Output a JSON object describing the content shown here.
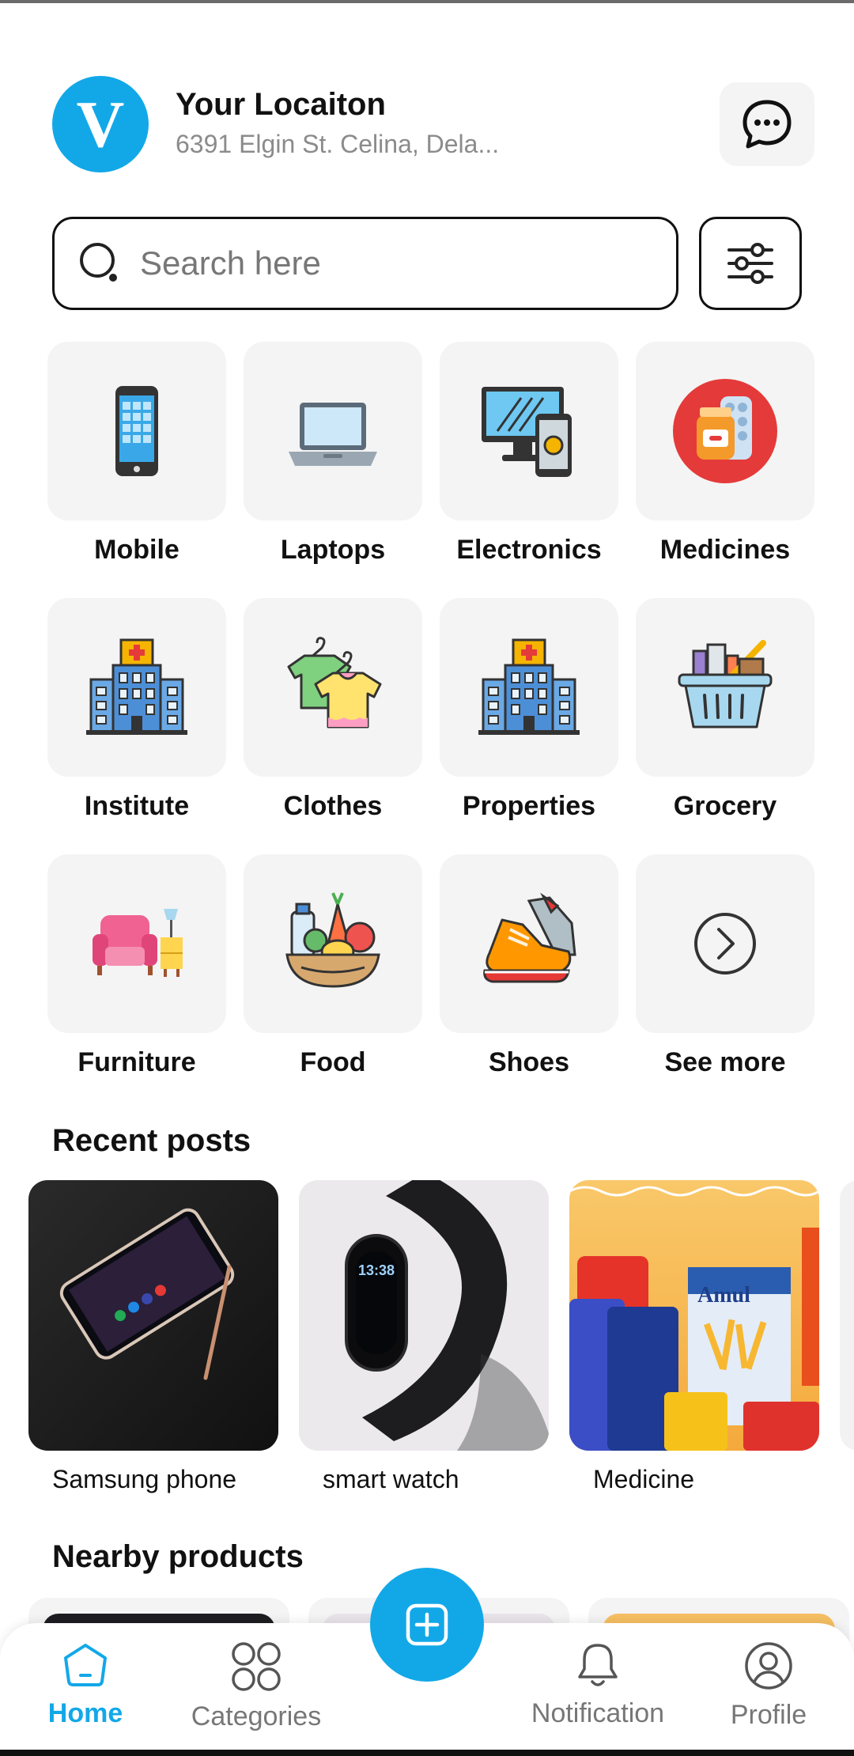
{
  "header": {
    "avatar_letter": "V",
    "location_title": "Your Locaiton",
    "location_address": "6391 Elgin St. Celina, Dela..."
  },
  "search": {
    "placeholder": "Search here"
  },
  "categories": [
    {
      "label": "Mobile",
      "icon": "mobile-phone-icon"
    },
    {
      "label": "Laptops",
      "icon": "laptop-icon"
    },
    {
      "label": "Electronics",
      "icon": "electronics-icon"
    },
    {
      "label": "Medicines",
      "icon": "medicine-icon"
    },
    {
      "label": "Institute",
      "icon": "institute-building-icon"
    },
    {
      "label": "Clothes",
      "icon": "clothes-icon"
    },
    {
      "label": "Properties",
      "icon": "properties-building-icon"
    },
    {
      "label": "Grocery",
      "icon": "grocery-basket-icon"
    },
    {
      "label": "Furniture",
      "icon": "furniture-icon"
    },
    {
      "label": "Food",
      "icon": "food-basket-icon"
    },
    {
      "label": "Shoes",
      "icon": "shoes-icon"
    },
    {
      "label": "See more",
      "icon": "chevron-right-circle-icon"
    }
  ],
  "recent_posts": {
    "title": "Recent posts",
    "items": [
      {
        "caption": "Samsung phone"
      },
      {
        "caption": "smart watch",
        "watch_time": "13:38"
      },
      {
        "caption": "Medicine",
        "brand_text": "Amul"
      }
    ]
  },
  "nearby": {
    "title": "Nearby products"
  },
  "nav": {
    "home": "Home",
    "categories": "Categories",
    "notification": "Notification",
    "profile": "Profile"
  },
  "colors": {
    "accent": "#12a8e8",
    "tile_bg": "#f4f4f4",
    "muted_text": "#8b8b8b"
  }
}
